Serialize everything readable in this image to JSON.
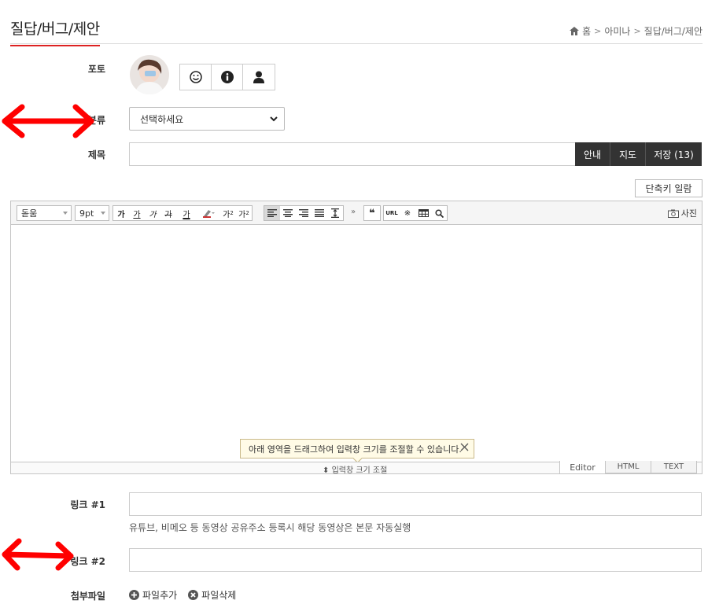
{
  "header": {
    "title": "질답/버그/제안",
    "breadcrumb": [
      "홈",
      "아미나",
      "질답/버그/제안"
    ]
  },
  "form": {
    "photo_label": "포토",
    "category_label": "분류",
    "category_value": "선택하세요",
    "subject_label": "제목",
    "subject_buttons": [
      "안내",
      "지도",
      "저장 (13)"
    ],
    "shortcut_button": "단축키 일람",
    "link1_label": "링크 #1",
    "link_hint": "유튜브, 비메오 등 동영상 공유주소 등록시 해당 동영상은 본문 자동실행",
    "link2_label": "링크 #2",
    "attach_label": "첨부파일",
    "attach_add": "파일추가",
    "attach_remove": "파일삭제"
  },
  "editor": {
    "font_family": "돋움",
    "font_size": "9pt",
    "format_buttons": [
      "가",
      "가",
      "가",
      "가",
      "가"
    ],
    "script_buttons": [
      "가",
      "가"
    ],
    "photo_label": "사진",
    "tooltip": "아래 영역을 드래그하여 입력창 크기를 조절할 수 있습니다.",
    "resize_label": "입력창 크기 조절",
    "modes": [
      "Editor",
      "HTML",
      "TEXT"
    ]
  },
  "colors": {
    "accent": "#d22222",
    "dark_button": "#333333",
    "annotation": "#ff0000"
  }
}
